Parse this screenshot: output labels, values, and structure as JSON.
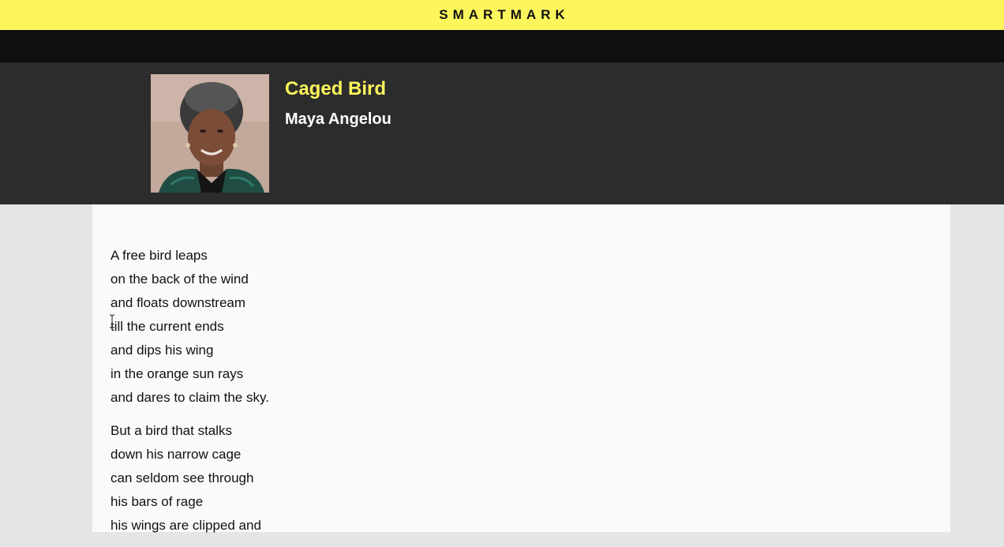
{
  "brand": {
    "name": "SMARTMARK"
  },
  "poem": {
    "title": "Caged Bird",
    "author": "Maya Angelou",
    "stanzas": [
      [
        "A free bird leaps",
        "on the back of the wind",
        "and floats downstream",
        "till the current ends",
        "and dips his wing",
        "in the orange sun rays",
        "and dares to claim the sky."
      ],
      [
        "But a bird that stalks",
        "down his narrow cage",
        "can seldom see through",
        "his bars of rage",
        "his wings are clipped and"
      ]
    ]
  },
  "colors": {
    "brand_bar": "#fdf55c",
    "header_bg": "#2c2c2c",
    "title_accent": "#fdf55c"
  },
  "icons": {
    "cursor": "text-cursor-icon"
  }
}
